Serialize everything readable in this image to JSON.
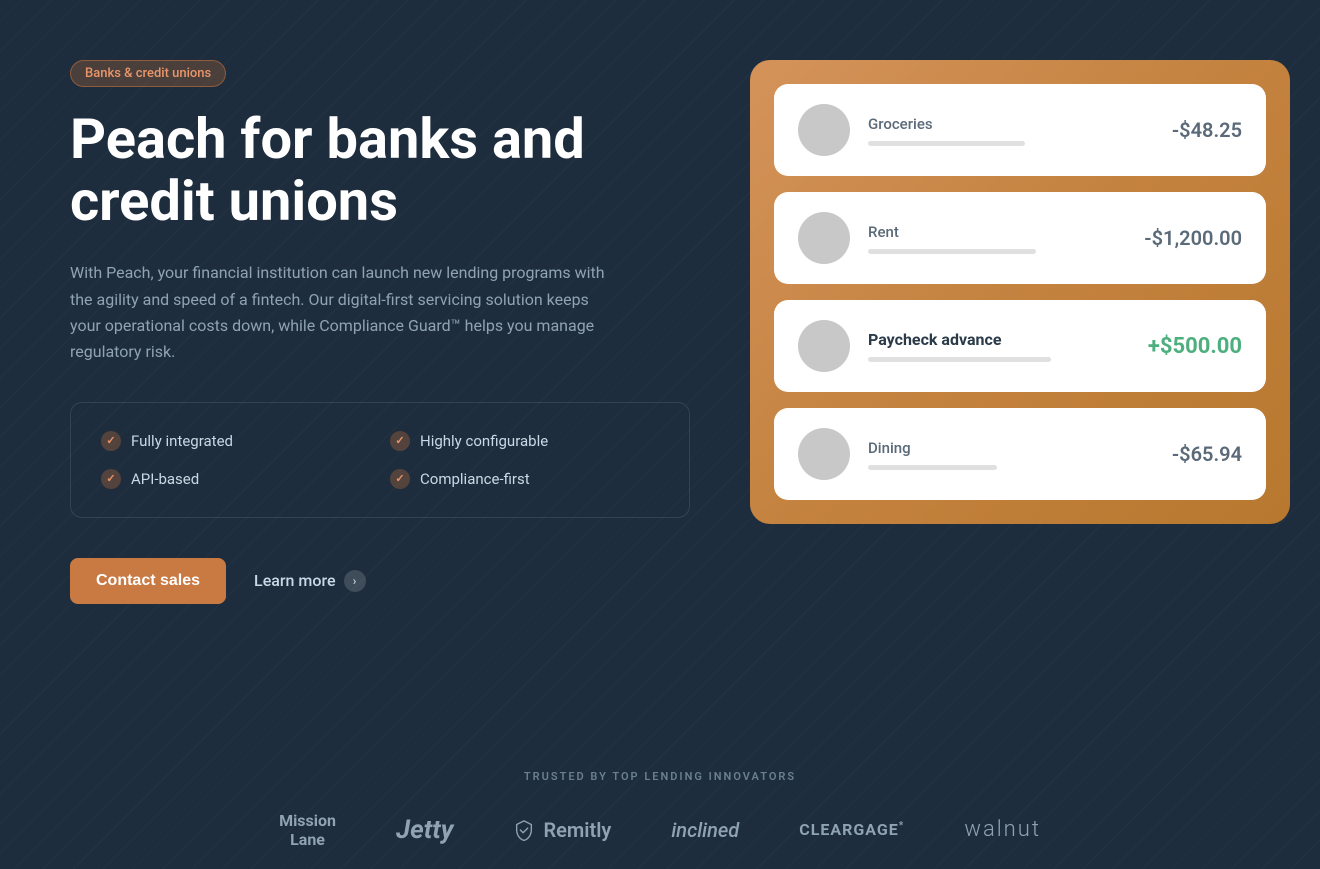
{
  "badge": {
    "label": "Banks & credit unions"
  },
  "hero": {
    "title": "Peach for banks and credit unions",
    "description": "With Peach, your financial institution can launch new lending programs with the agility and speed of a fintech. Our digital-first servicing solution keeps your operational costs down, while Compliance Guard™ helps you manage regulatory risk."
  },
  "features": [
    {
      "id": "f1",
      "label": "Fully integrated"
    },
    {
      "id": "f2",
      "label": "Highly configurable"
    },
    {
      "id": "f3",
      "label": "API-based"
    },
    {
      "id": "f4",
      "label": "Compliance-first"
    }
  ],
  "cta": {
    "contact_sales": "Contact sales",
    "learn_more": "Learn more"
  },
  "transactions": [
    {
      "id": "t1",
      "name": "Groceries",
      "amount": "-$48.25",
      "positive": false,
      "bold": false,
      "bar_width": "55%"
    },
    {
      "id": "t2",
      "name": "Rent",
      "amount": "-$1,200.00",
      "positive": false,
      "bold": false,
      "bar_width": "65%"
    },
    {
      "id": "t3",
      "name": "Paycheck advance",
      "amount": "+$500.00",
      "positive": true,
      "bold": true,
      "bar_width": "70%"
    },
    {
      "id": "t4",
      "name": "Dining",
      "amount": "-$65.94",
      "positive": false,
      "bold": false,
      "bar_width": "45%"
    }
  ],
  "trusted": {
    "label": "Trusted by top lending innovators",
    "logos": [
      {
        "id": "mission-lane",
        "text": "Mission\nLane"
      },
      {
        "id": "jetty",
        "text": "Jetty"
      },
      {
        "id": "remitly",
        "text": "Remitly"
      },
      {
        "id": "inclined",
        "text": "inclined"
      },
      {
        "id": "cleargage",
        "text": "CLEARGAGE"
      },
      {
        "id": "walnut",
        "text": "walnut"
      }
    ]
  }
}
